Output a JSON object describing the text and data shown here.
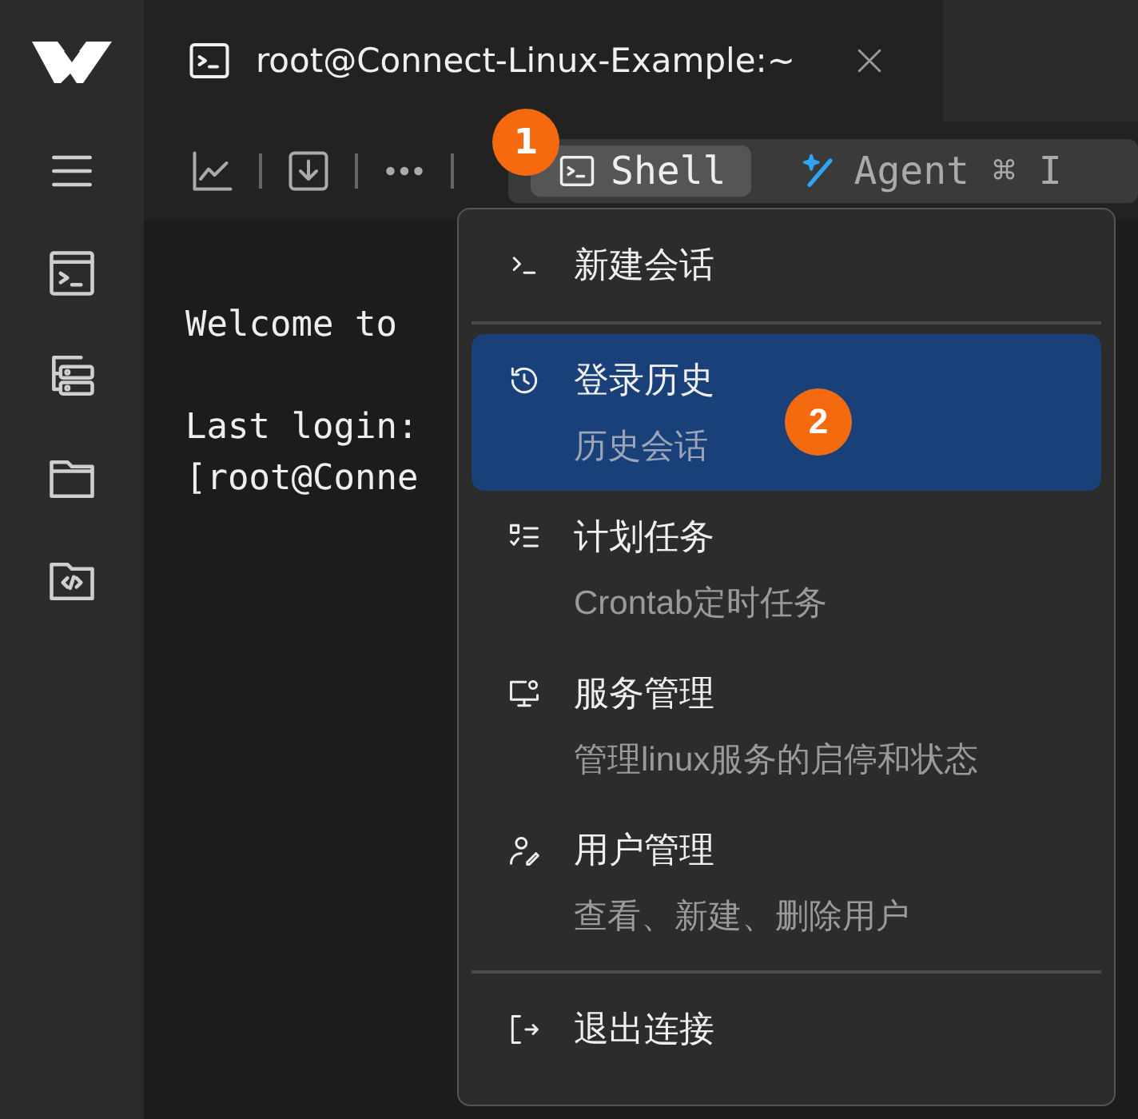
{
  "session_tab": {
    "title": "root@Connect-Linux-Example:~"
  },
  "mode_tabs": [
    {
      "label": "Shell",
      "selected": true
    },
    {
      "label": "Agent ⌘ I",
      "selected": false
    }
  ],
  "terminal": {
    "blocks": [
      [
        "Welcome to"
      ],
      [
        "Last login:",
        "[root@Conne"
      ]
    ]
  },
  "menu": {
    "items": [
      {
        "kind": "item",
        "label": "新建会话",
        "selected": false
      },
      {
        "kind": "separator"
      },
      {
        "kind": "item",
        "label": "登录历史",
        "description": "历史会话",
        "selected": true
      },
      {
        "kind": "item",
        "label": "计划任务",
        "description": "Crontab定时任务",
        "selected": false
      },
      {
        "kind": "item",
        "label": "服务管理",
        "description": "管理linux服务的启停和状态",
        "selected": false
      },
      {
        "kind": "item",
        "label": "用户管理",
        "description": "查看、新建、删除用户",
        "selected": false
      },
      {
        "kind": "separator"
      },
      {
        "kind": "item",
        "label": "退出连接",
        "selected": false
      }
    ]
  },
  "annotations": [
    {
      "label": "1"
    },
    {
      "label": "2"
    }
  ]
}
